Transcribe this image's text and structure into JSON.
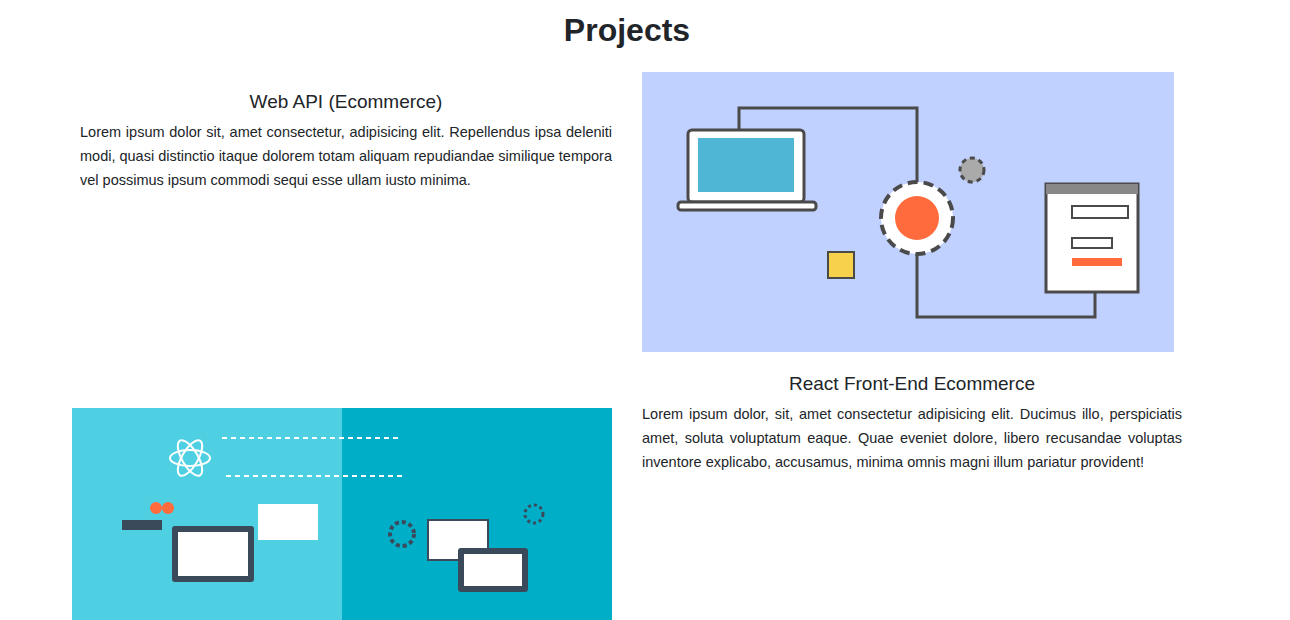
{
  "section": {
    "title": "Projects"
  },
  "projects": [
    {
      "title": "Web API (Ecommerce)",
      "description": "Lorem ipsum dolor sit, amet consectetur, adipisicing elit. Repellendus ipsa deleniti modi, quasi distinctio itaque dolorem totam aliquam repudiandae similique tempora vel possimus ipsum commodi sequi esse ullam iusto minima.",
      "kind": "api"
    },
    {
      "title": "React Front-End Ecommerce",
      "description": "Lorem ipsum dolor, sit, amet consectetur adipisicing elit. Ducimus illo, perspiciatis amet, soluta voluptatum eaque. Quae eveniet dolore, libero recusandae voluptas inventore explicabo, accusamus, minima omnis magni illum pariatur provident!",
      "kind": "react"
    }
  ]
}
